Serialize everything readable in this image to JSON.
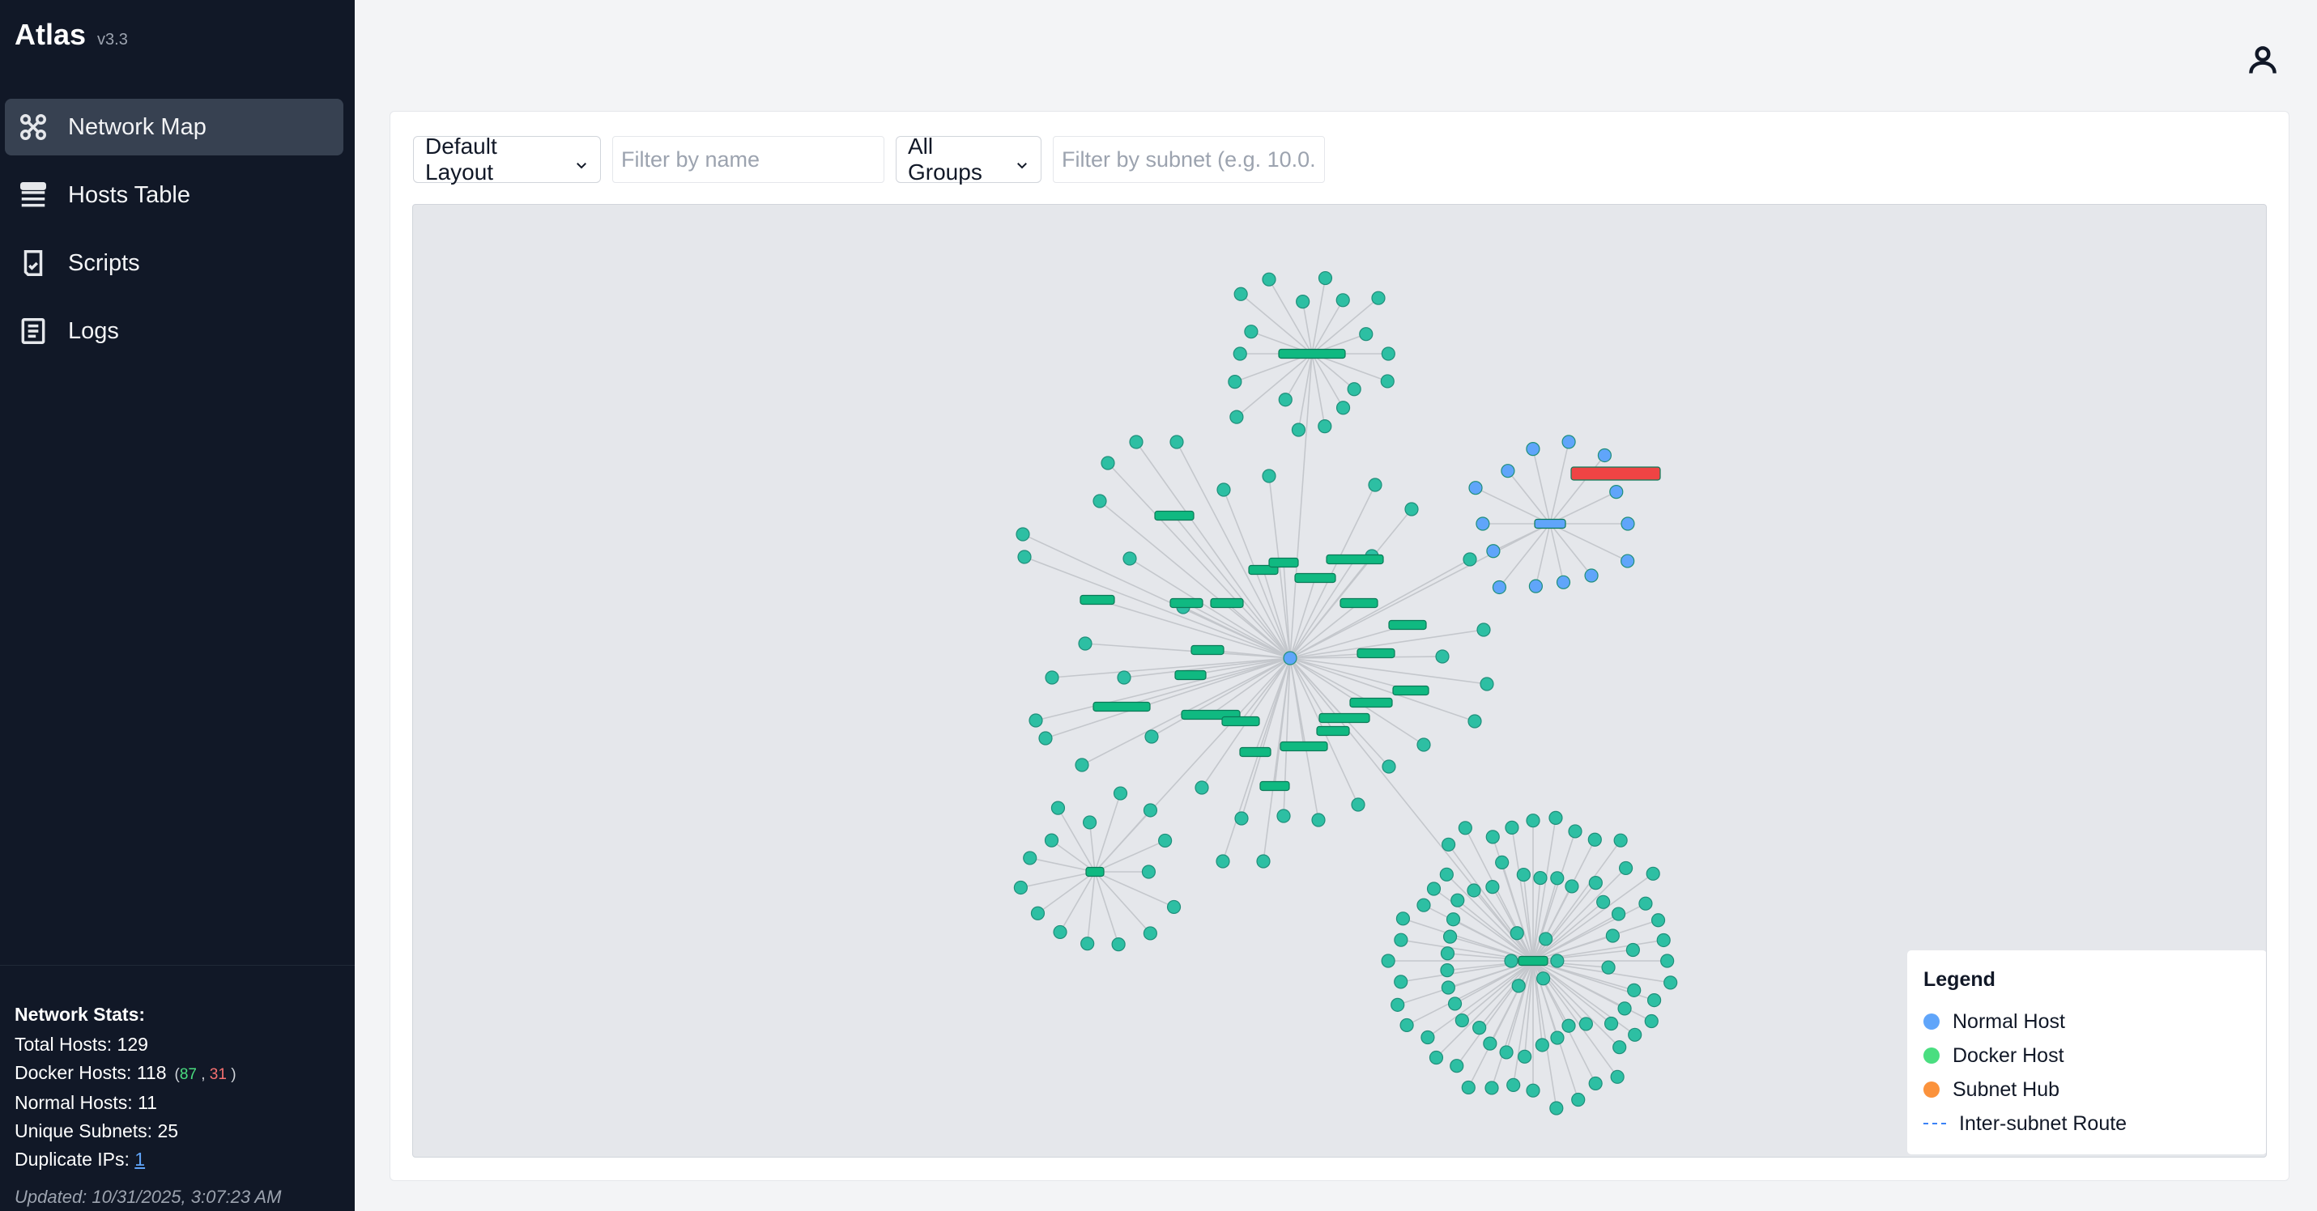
{
  "app": {
    "title": "Atlas",
    "version": "v3.3"
  },
  "nav": {
    "items": [
      {
        "label": "Network Map",
        "icon": "network-icon",
        "active": true
      },
      {
        "label": "Hosts Table",
        "icon": "table-icon",
        "active": false
      },
      {
        "label": "Scripts",
        "icon": "script-icon",
        "active": false
      },
      {
        "label": "Logs",
        "icon": "logs-icon",
        "active": false
      }
    ]
  },
  "stats": {
    "title": "Network Stats:",
    "total_hosts": "Total Hosts: 129",
    "docker_hosts": "Docker Hosts: 118",
    "docker_running": "87",
    "docker_sep": ",",
    "docker_stopped": "31",
    "normal_hosts": "Normal Hosts: 11",
    "unique_subnets": "Unique Subnets: 25",
    "duplicate_label": "Duplicate IPs: ",
    "duplicate_count": "1",
    "updated": "Updated: 10/31/2025, 3:07:23 AM"
  },
  "header": {
    "user_icon": "user-icon"
  },
  "toolbar": {
    "layout_value": "Default Layout",
    "name_placeholder": "Filter by name",
    "group_value": "All Groups",
    "subnet_placeholder": "Filter by subnet (e.g. 10.0."
  },
  "legend": {
    "title": "Legend",
    "items": [
      {
        "label": "Normal Host",
        "color": "#60a5fa"
      },
      {
        "label": "Docker Host",
        "color": "#4ade80"
      },
      {
        "label": "Subnet Hub",
        "color": "#fb923c"
      },
      {
        "label": "Inter-subnet Route",
        "color": "#3b82f6"
      }
    ]
  },
  "colors": {
    "docker_node": "#2dbfa3",
    "normal_node": "#60a5fa",
    "hub": "#10b981",
    "alert": "#ef4444",
    "edge": "#c4c7cc"
  }
}
